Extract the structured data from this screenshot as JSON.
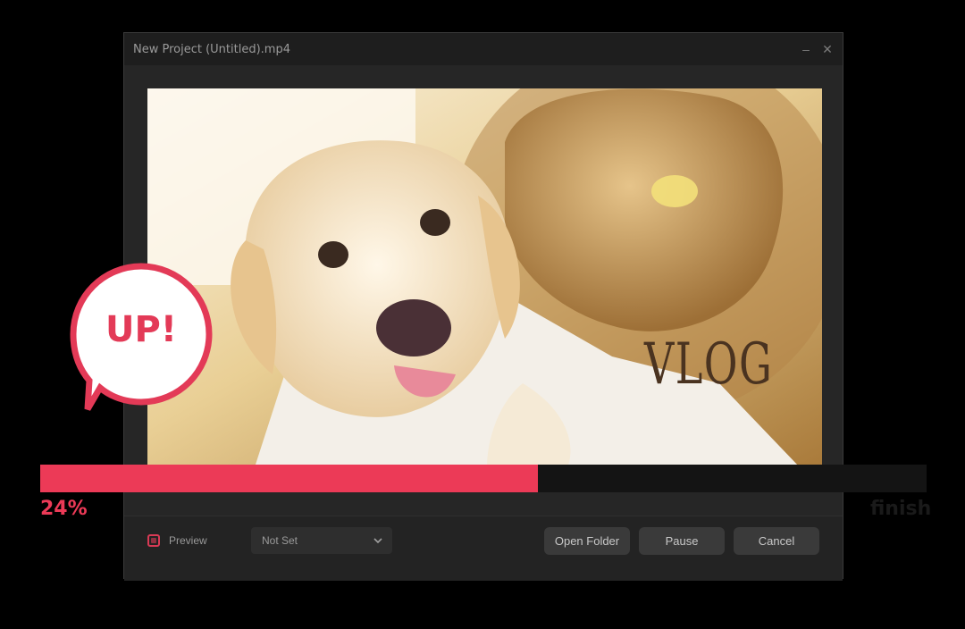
{
  "window": {
    "title": "New Project (Untitled).mp4",
    "minimize_glyph": "–",
    "close_glyph": "✕"
  },
  "preview": {
    "overlay_text": "VLOG"
  },
  "bottombar": {
    "preview_label": "Preview",
    "select_value": "Not Set",
    "open_folder_label": "Open Folder",
    "pause_label": "Pause",
    "cancel_label": "Cancel"
  },
  "progress": {
    "value": 0.24,
    "percent_text": "24%",
    "finish_text": "finish"
  },
  "badge": {
    "text": "UP!"
  },
  "colors": {
    "accent": "#ec3a57",
    "window_bg": "#262626",
    "titlebar_bg": "#1e1e1e",
    "button_bg": "#3a3a3a"
  },
  "icons": {
    "preview_checkbox": "checkbox-icon",
    "select_arrow": "chevron-down-icon",
    "minimize": "minimize-icon",
    "close": "close-icon",
    "badge": "speech-bubble-icon"
  }
}
